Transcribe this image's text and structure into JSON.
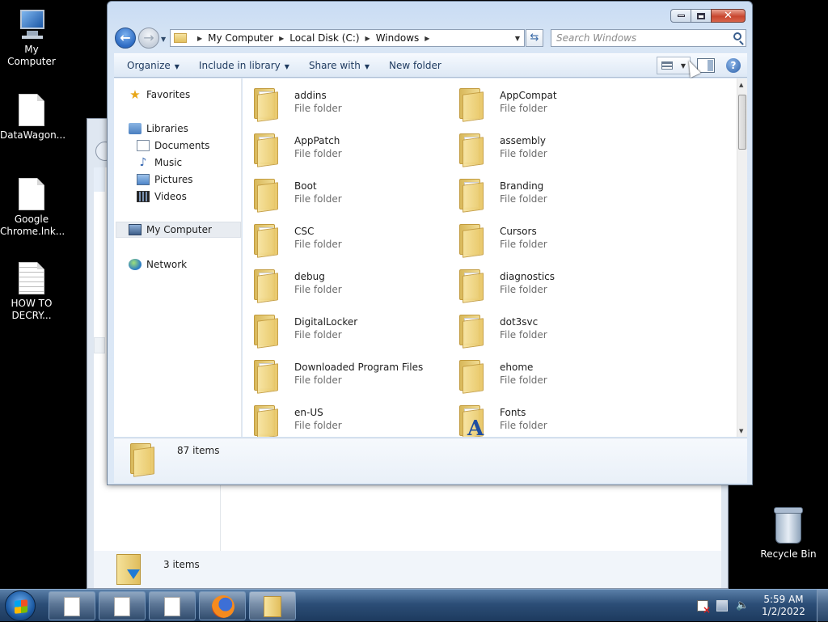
{
  "desktop": {
    "icons": [
      {
        "label": "My Computer",
        "icon": "computer-icon"
      },
      {
        "label": "DataWagon...",
        "icon": "document-icon"
      },
      {
        "label": "Google Chrome.lnk...",
        "icon": "document-icon"
      },
      {
        "label": "HOW TO DECRY...",
        "icon": "text-document-icon"
      }
    ],
    "recycle_bin": "Recycle Bin"
  },
  "background_window": {
    "status_count": "3 items"
  },
  "window": {
    "caption_buttons": {
      "minimize": "minimize",
      "maximize": "maximize",
      "close": "✕"
    },
    "address": {
      "crumbs": [
        "My Computer",
        "Local Disk (C:)",
        "Windows"
      ]
    },
    "search_placeholder": "Search Windows",
    "toolbar": {
      "organize": "Organize",
      "include_in_library": "Include in library",
      "share_with": "Share with",
      "new_folder": "New folder"
    },
    "nav": {
      "favorites": "Favorites",
      "libraries": "Libraries",
      "documents": "Documents",
      "music": "Music",
      "pictures": "Pictures",
      "videos": "Videos",
      "my_computer": "My Computer",
      "network": "Network"
    },
    "items": [
      {
        "name": "addins",
        "type": "File folder"
      },
      {
        "name": "AppCompat",
        "type": "File folder"
      },
      {
        "name": "AppPatch",
        "type": "File folder"
      },
      {
        "name": "assembly",
        "type": "File folder"
      },
      {
        "name": "Boot",
        "type": "File folder"
      },
      {
        "name": "Branding",
        "type": "File folder"
      },
      {
        "name": "CSC",
        "type": "File folder"
      },
      {
        "name": "Cursors",
        "type": "File folder"
      },
      {
        "name": "debug",
        "type": "File folder"
      },
      {
        "name": "diagnostics",
        "type": "File folder"
      },
      {
        "name": "DigitalLocker",
        "type": "File folder"
      },
      {
        "name": "dot3svc",
        "type": "File folder"
      },
      {
        "name": "Downloaded Program Files",
        "type": "File folder"
      },
      {
        "name": "ehome",
        "type": "File folder"
      },
      {
        "name": "en-US",
        "type": "File folder"
      },
      {
        "name": "Fonts",
        "type": "File folder"
      }
    ],
    "details_count": "87 items"
  },
  "taskbar": {
    "clock_time": "5:59 AM",
    "clock_date": "1/2/2022"
  }
}
